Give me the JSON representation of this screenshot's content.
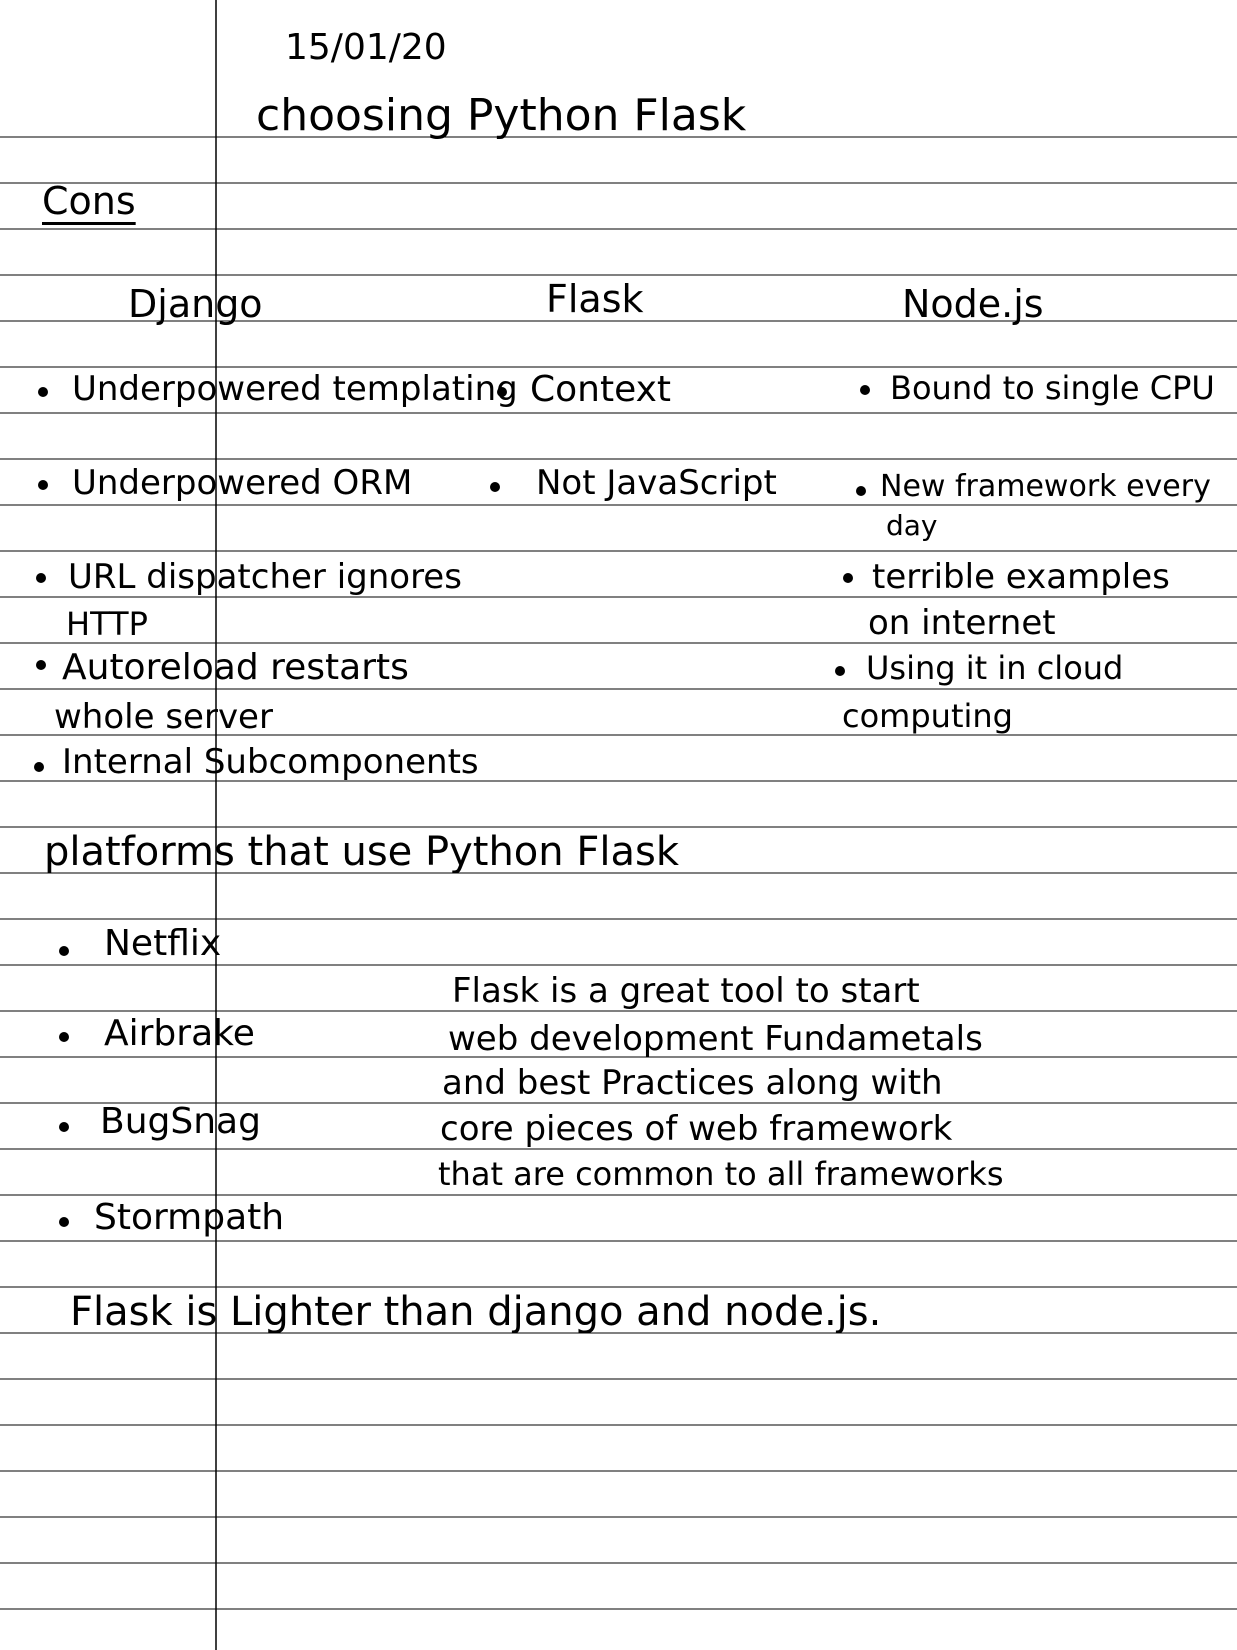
{
  "paper": {
    "date": "15/01/20",
    "title": "choosing Python Flask",
    "cons_heading": "Cons",
    "columns": {
      "django": {
        "heading": "Django",
        "items": [
          [
            "Underpowered templating"
          ],
          [
            "Underpowered ORM"
          ],
          [
            "URL dispatcher ignores",
            "HTTP"
          ],
          [
            "Autoreload restarts",
            "whole server"
          ],
          [
            "Internal Subcomponents"
          ]
        ]
      },
      "flask": {
        "heading": "Flask",
        "items": [
          [
            "Context"
          ],
          [
            "Not JavaScript"
          ]
        ]
      },
      "node": {
        "heading": "Node.js",
        "items": [
          [
            "Bound to single CPU"
          ],
          [
            "New framework every",
            "day"
          ],
          [
            "terrible examples",
            "on internet"
          ],
          [
            "Using it in cloud",
            "computing"
          ]
        ]
      }
    },
    "platforms": {
      "heading": "platforms that use Python Flask",
      "items": [
        "Netflix",
        "Airbrake",
        "BugSnag",
        "Stormpath"
      ]
    },
    "note": [
      "Flask is a great tool to start",
      "web development Fundametals",
      "and best Practices along with",
      "core pieces of web framework",
      "that are common to all frameworks"
    ],
    "conclusion": "Flask is Lighter than django and node.js."
  },
  "colors": {
    "ink": "#000000",
    "rule": "#000000",
    "paper": "#ffffff"
  }
}
